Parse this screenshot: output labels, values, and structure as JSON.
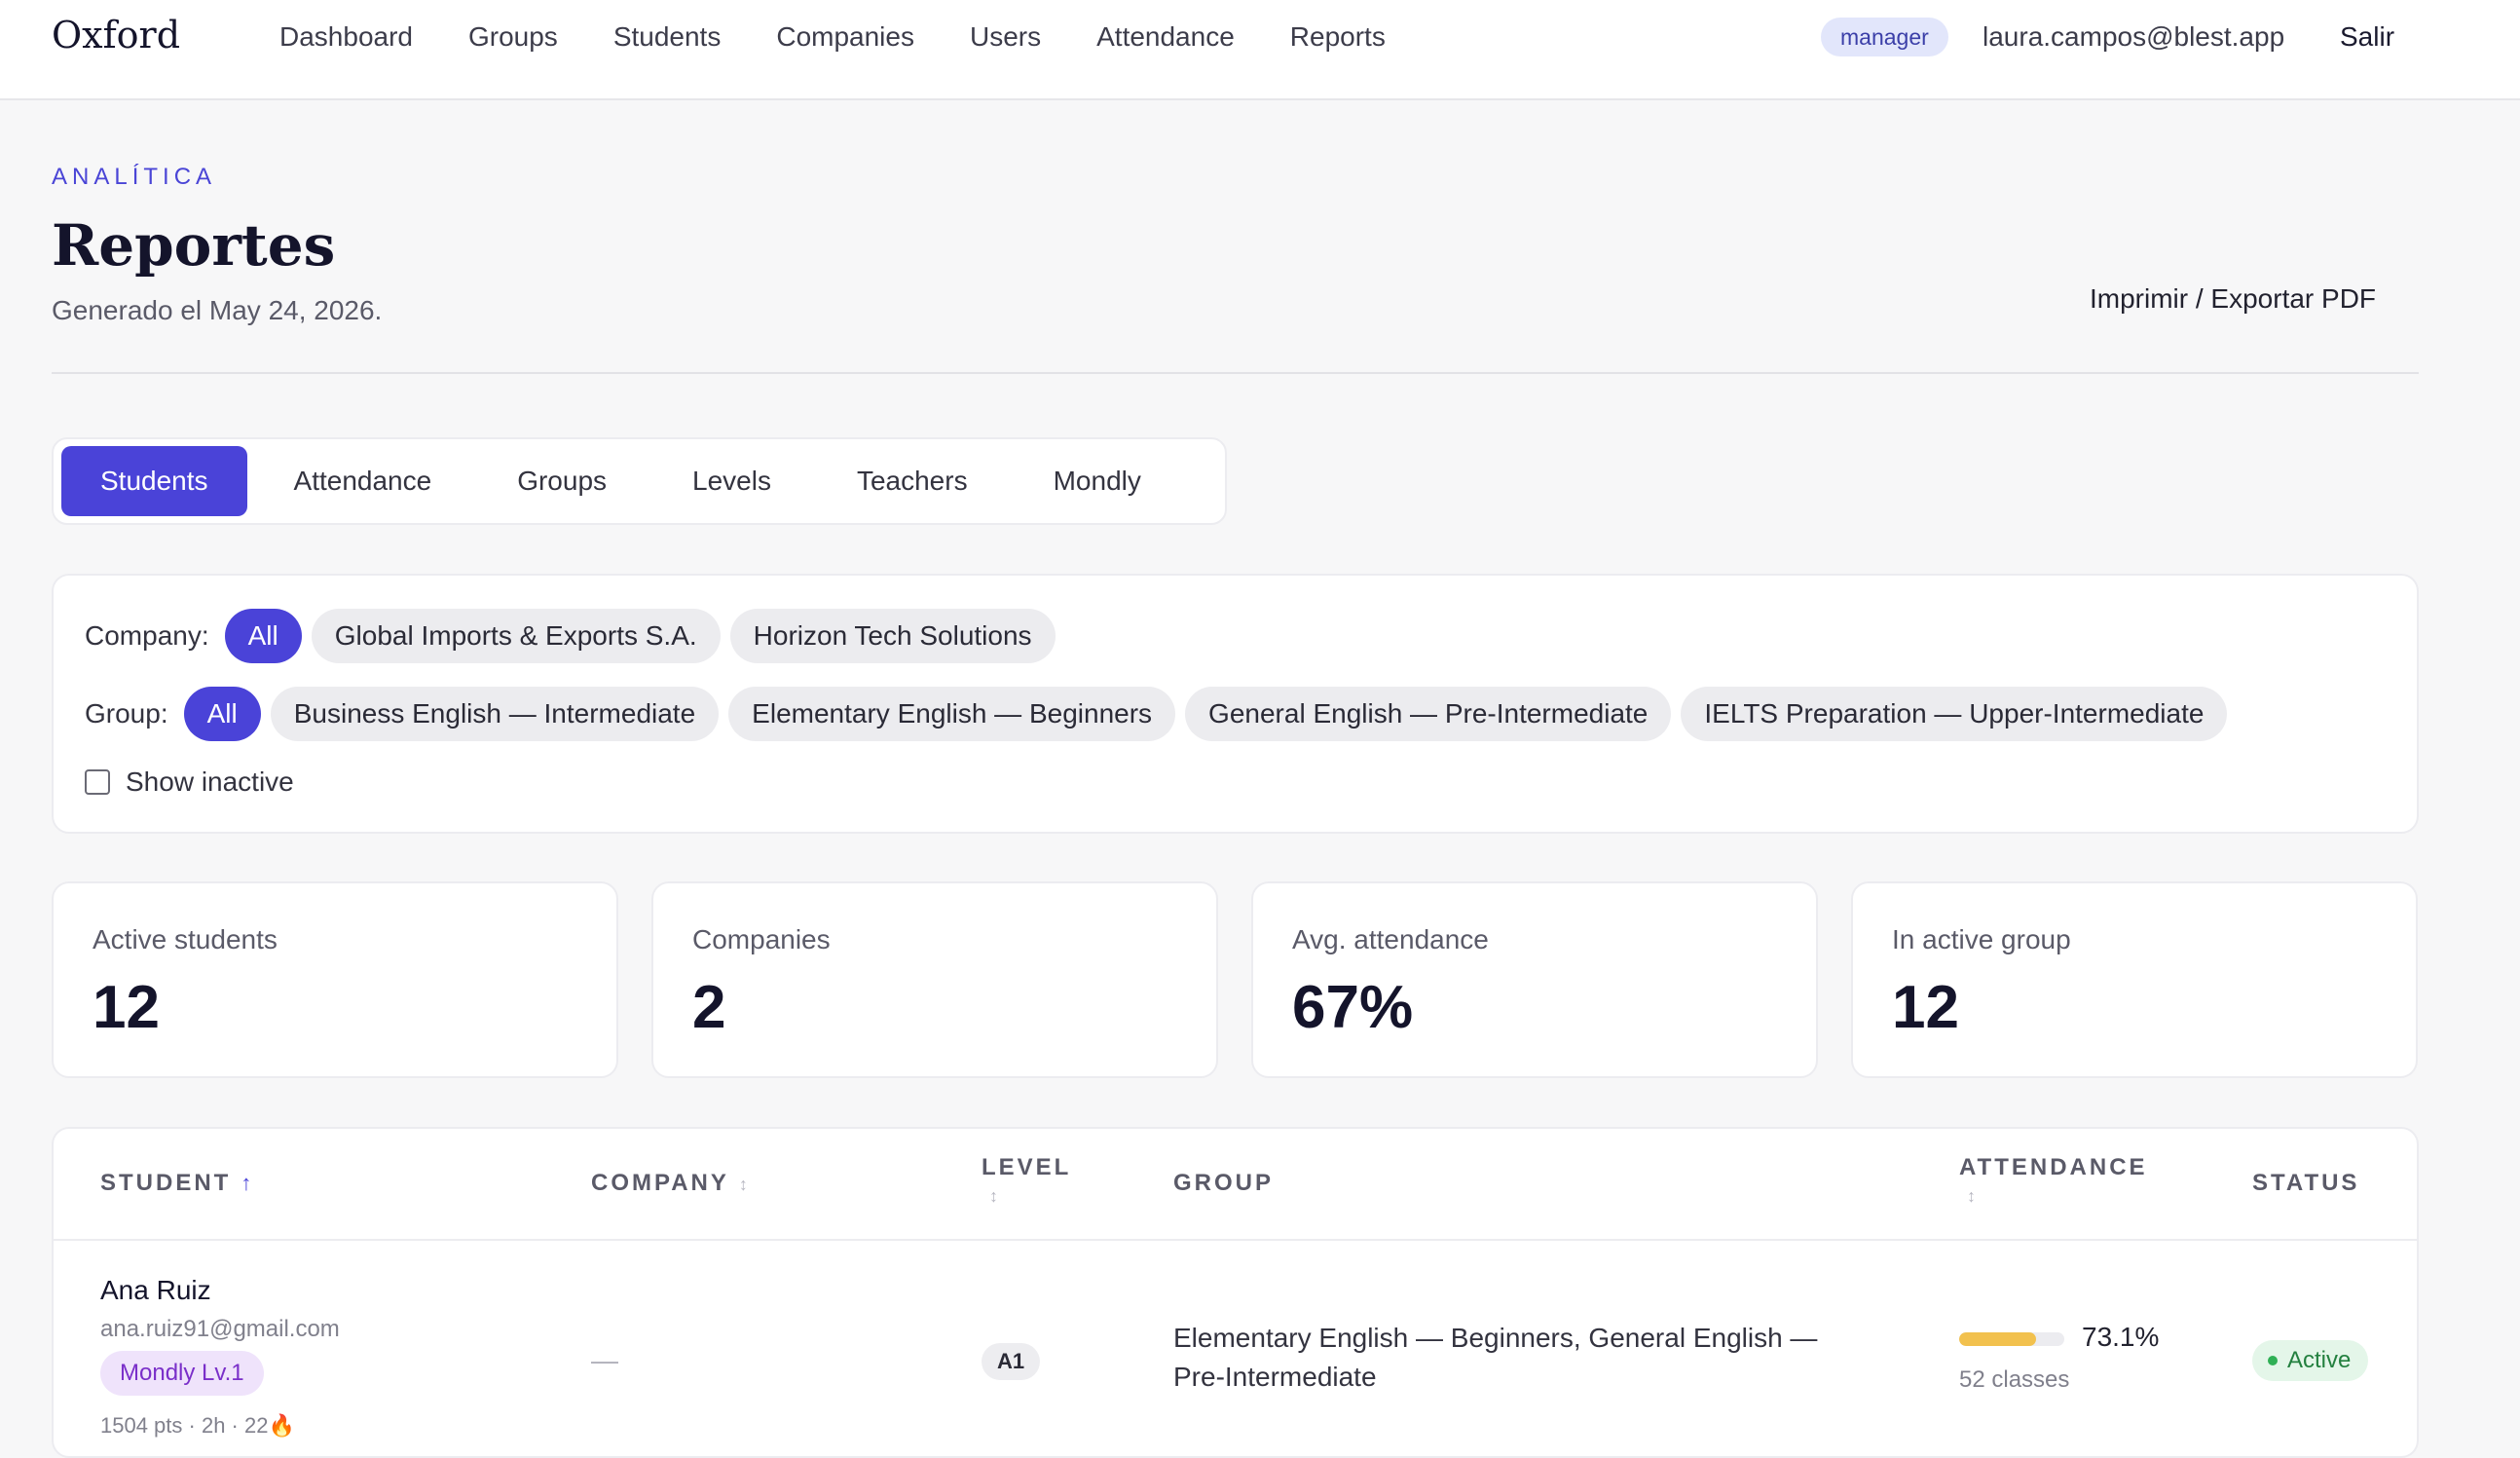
{
  "nav": {
    "brand": "Oxford",
    "links": [
      "Dashboard",
      "Groups",
      "Students",
      "Companies",
      "Users",
      "Attendance",
      "Reports"
    ],
    "role": "manager",
    "email": "laura.campos@blest.app",
    "logout": "Salir"
  },
  "header": {
    "eyebrow": "ANALÍTICA",
    "title": "Reportes",
    "generated": "Generado el May 24, 2026.",
    "print_label": "Imprimir / Exportar PDF"
  },
  "tabs": [
    "Students",
    "Attendance",
    "Groups",
    "Levels",
    "Teachers",
    "Mondly"
  ],
  "active_tab": "Students",
  "filters": {
    "company_label": "Company:",
    "company_options": [
      "All",
      "Global Imports & Exports S.A.",
      "Horizon Tech Solutions"
    ],
    "group_label": "Group:",
    "group_options": [
      "All",
      "Business English — Intermediate",
      "Elementary English — Beginners",
      "General English — Pre-Intermediate",
      "IELTS Preparation — Upper-Intermediate"
    ],
    "show_inactive_label": "Show inactive",
    "show_inactive_checked": false
  },
  "stats": [
    {
      "label": "Active students",
      "value": "12"
    },
    {
      "label": "Companies",
      "value": "2"
    },
    {
      "label": "Avg. attendance",
      "value": "67%"
    },
    {
      "label": "In active group",
      "value": "12"
    }
  ],
  "table": {
    "headers": {
      "student": "STUDENT",
      "company": "COMPANY",
      "level": "LEVEL",
      "group": "GROUP",
      "attendance": "ATTENDANCE",
      "status": "STATUS"
    },
    "sort_icons": {
      "active": "↑",
      "inactive": "↕"
    },
    "rows": [
      {
        "name": "Ana Ruiz",
        "email": "ana.ruiz91@gmail.com",
        "mondly": "Mondly Lv.1",
        "meta": "1504 pts · 2h · 22🔥",
        "company": "—",
        "level": "A1",
        "group": "Elementary English — Beginners, General English — Pre-Intermediate",
        "attendance_pct": "73.1%",
        "attendance_fraction": 0.731,
        "classes": "52 classes",
        "status": "Active"
      }
    ]
  },
  "colors": {
    "accent": "#4a43d8",
    "attendance_bar": "#f2c14e",
    "status_active": "#23803f"
  }
}
